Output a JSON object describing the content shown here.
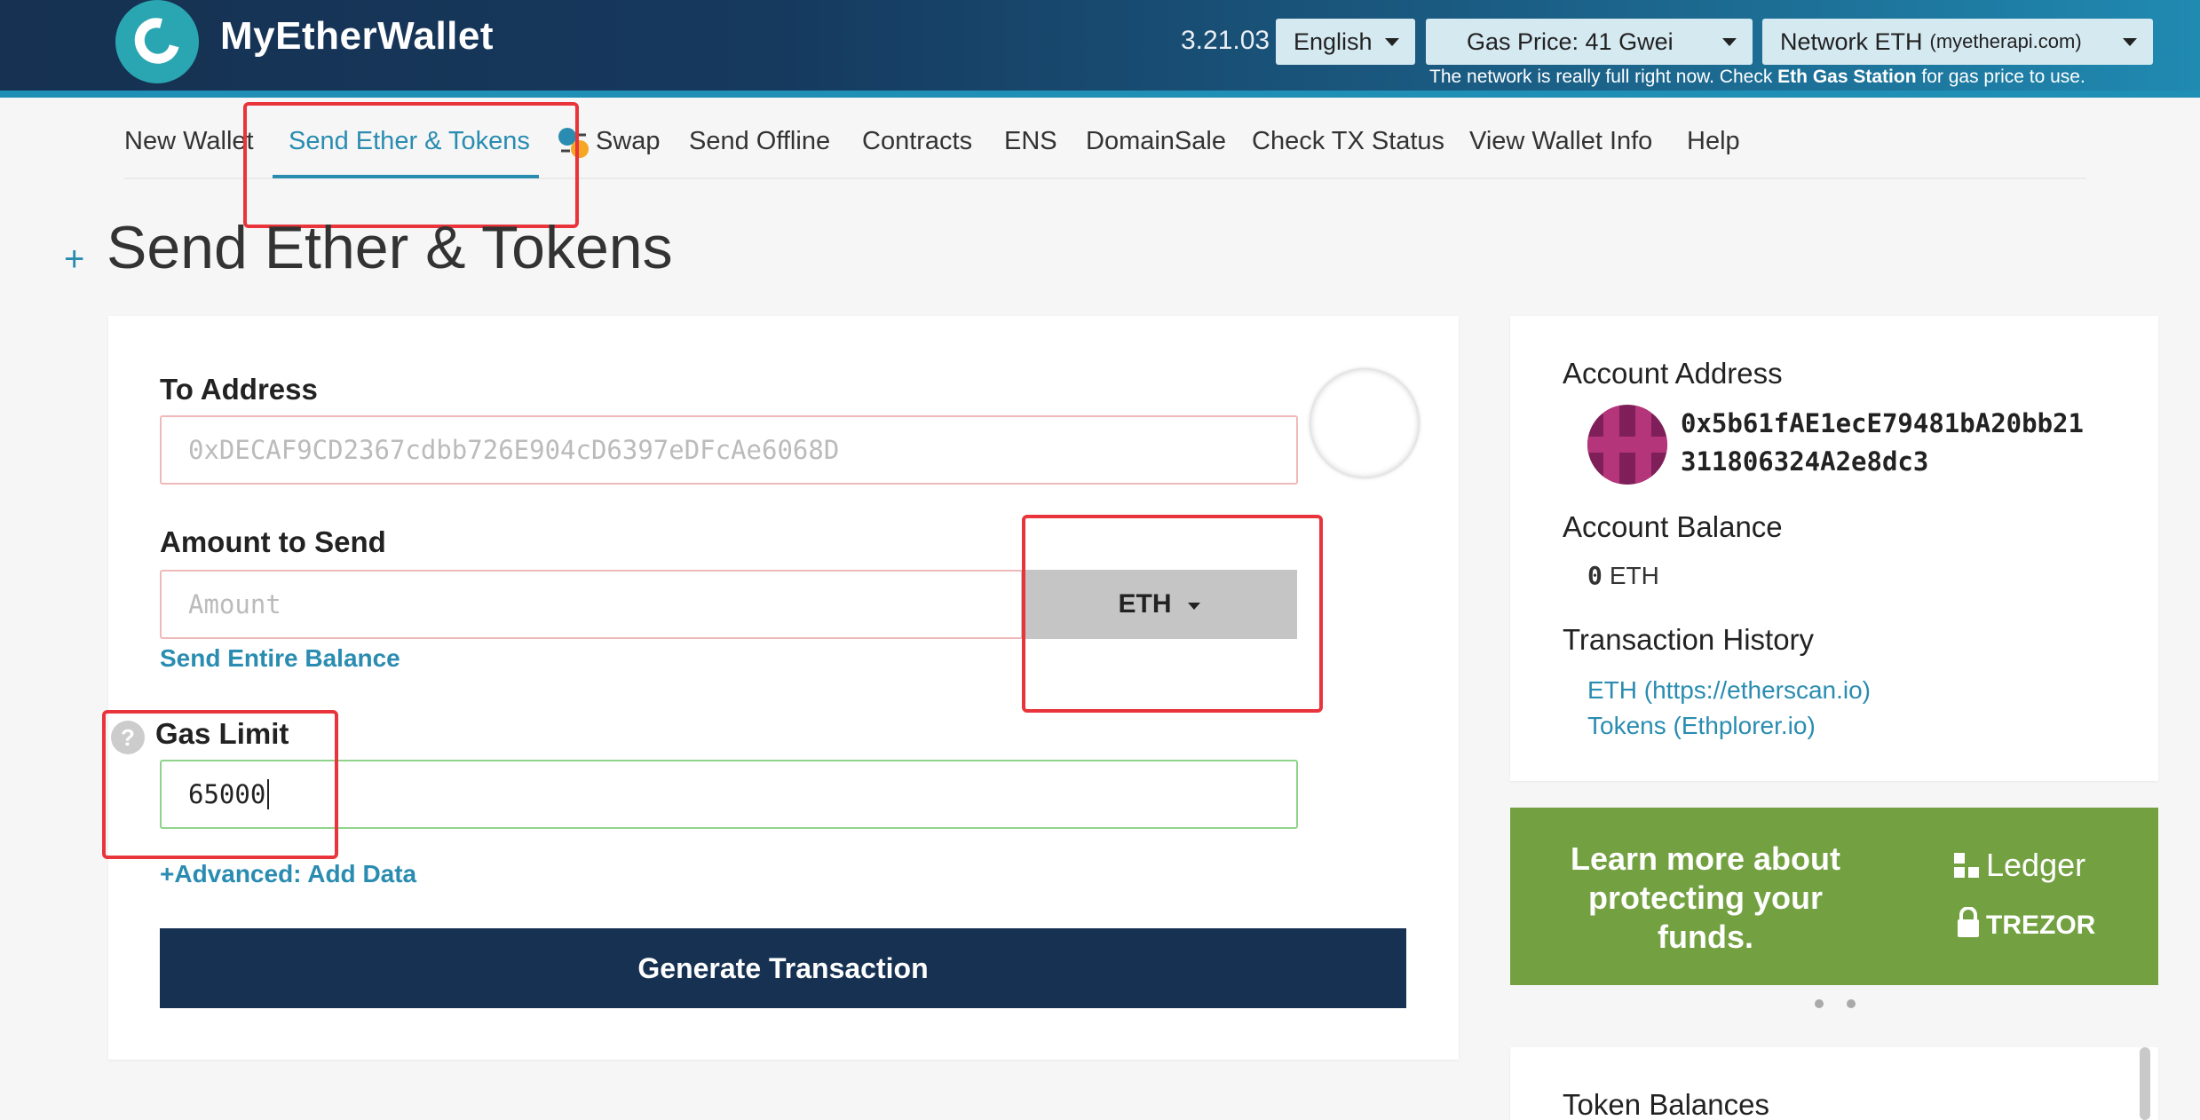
{
  "header": {
    "logo_text": "MyEtherWallet",
    "version": "3.21.03",
    "language": "English",
    "gas_price": "Gas Price: 41 Gwei",
    "network": "Network ETH",
    "network_host": "(myetherapi.com)",
    "network_note_pre": "The network is really full right now. Check ",
    "network_note_link": "Eth Gas Station",
    "network_note_post": " for gas price to use."
  },
  "nav": {
    "items": [
      "New Wallet",
      "Send Ether & Tokens",
      "Swap",
      "Send Offline",
      "Contracts",
      "ENS",
      "DomainSale",
      "Check TX Status",
      "View Wallet Info",
      "Help"
    ],
    "active": "Send Ether & Tokens"
  },
  "page": {
    "title": "Send Ether & Tokens",
    "expand_icon": "+"
  },
  "form": {
    "to_label": "To Address",
    "to_placeholder": "0xDECAF9CD2367cdbb726E904cD6397eDFcAe6068D",
    "amount_label": "Amount to Send",
    "amount_placeholder": "Amount",
    "currency": "ETH",
    "send_entire_balance": "Send Entire Balance",
    "gas_label": "Gas Limit",
    "gas_value": "65000",
    "help_icon": "?",
    "advanced_link": "+Advanced: Add Data",
    "generate_button": "Generate Transaction"
  },
  "sidebar": {
    "account_address_label": "Account Address",
    "address_line1": "0x5b61fAE1ecE79481bA20bb21",
    "address_line2": "311806324A2e8dc3",
    "account_balance_label": "Account Balance",
    "balance_value": "0",
    "balance_unit": "ETH",
    "tx_history_label": "Transaction History",
    "tx_links": [
      "ETH (https://etherscan.io)",
      "Tokens (Ethplorer.io)"
    ],
    "promo_text": "Learn more about protecting your funds.",
    "promo_brands": [
      "Ledger",
      "TREZOR"
    ],
    "token_balances_label": "Token Balances"
  },
  "colors": {
    "accent": "#2a8cb1",
    "header_dark": "#163151",
    "annotation": "#e8343a",
    "promo_green": "#73a141"
  }
}
